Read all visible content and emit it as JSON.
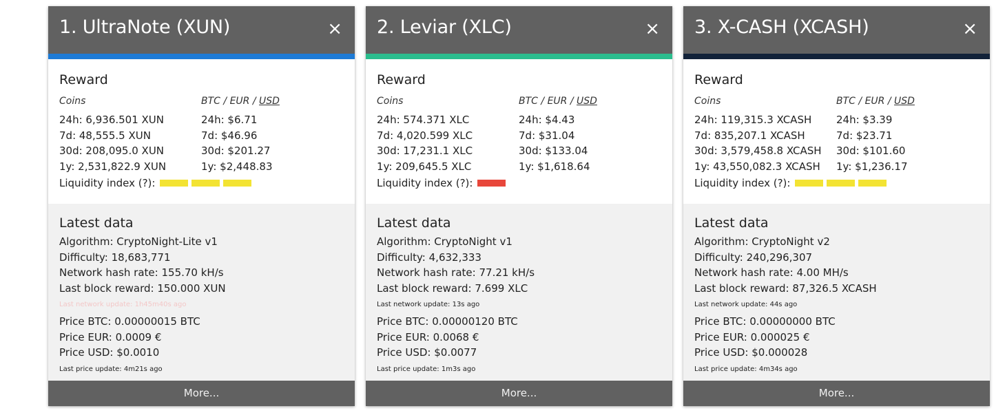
{
  "labels": {
    "reward": "Reward",
    "coins": "Coins",
    "btc": "BTC",
    "eur": "EUR",
    "usd": "USD",
    "sep": " / ",
    "liquidity": "Liquidity index (?):",
    "latest": "Latest data",
    "more": "More...",
    "close": "×"
  },
  "cards": [
    {
      "title": "1. UltraNote (XUN)",
      "accent_color": "#1e7bd6",
      "reward_coins": [
        "24h: 6,936.501 XUN",
        "7d: 48,555.5 XUN",
        "30d: 208,095.0 XUN",
        "1y: 2,531,822.9 XUN"
      ],
      "reward_fiat": [
        "24h: $6.71",
        "7d: $46.96",
        "30d: $201.27",
        "1y: $2,448.83"
      ],
      "liquidity_bars": 3,
      "liquidity_color": "#f3e333",
      "algorithm": "Algorithm: CryptoNight-Lite v1",
      "difficulty": "Difficulty: 18,683,771",
      "hashrate": "Network hash rate: 155.70 kH/s",
      "block_reward": "Last block reward: 150.000 XUN",
      "network_update": "Last network update: 1h45m40s ago",
      "network_update_stale": true,
      "price_btc": "Price BTC: 0.00000015 BTC",
      "price_eur": "Price EUR: 0.0009 €",
      "price_usd": "Price USD: $0.0010",
      "price_update": "Last price update: 4m21s ago"
    },
    {
      "title": "2. Leviar (XLC)",
      "accent_color": "#2bbd8e",
      "reward_coins": [
        "24h: 574.371 XLC",
        "7d: 4,020.599 XLC",
        "30d: 17,231.1 XLC",
        "1y: 209,645.5 XLC"
      ],
      "reward_fiat": [
        "24h: $4.43",
        "7d: $31.04",
        "30d: $133.04",
        "1y: $1,618.64"
      ],
      "liquidity_bars": 1,
      "liquidity_color": "#e8473b",
      "algorithm": "Algorithm: CryptoNight v1",
      "difficulty": "Difficulty: 4,632,333",
      "hashrate": "Network hash rate: 77.21 kH/s",
      "block_reward": "Last block reward: 7.699 XLC",
      "network_update": "Last network update: 13s ago",
      "network_update_stale": false,
      "price_btc": "Price BTC: 0.00000120 BTC",
      "price_eur": "Price EUR: 0.0068 €",
      "price_usd": "Price USD: $0.0077",
      "price_update": "Last price update: 1m3s ago"
    },
    {
      "title": "3. X-CASH (XCASH)",
      "accent_color": "#122239",
      "reward_coins": [
        "24h: 119,315.3 XCASH",
        "7d: 835,207.1 XCASH",
        "30d: 3,579,458.8 XCASH",
        "1y: 43,550,082.3 XCASH"
      ],
      "reward_fiat": [
        "24h: $3.39",
        "7d: $23.71",
        "30d: $101.60",
        "1y: $1,236.17"
      ],
      "liquidity_bars": 3,
      "liquidity_color": "#f3e333",
      "algorithm": "Algorithm: CryptoNight v2",
      "difficulty": "Difficulty: 240,296,307",
      "hashrate": "Network hash rate: 4.00 MH/s",
      "block_reward": "Last block reward: 87,326.5 XCASH",
      "network_update": "Last network update: 44s ago",
      "network_update_stale": false,
      "price_btc": "Price BTC: 0.00000000 BTC",
      "price_eur": "Price EUR: 0.000025 €",
      "price_usd": "Price USD: $0.000028",
      "price_update": "Last price update: 4m34s ago"
    }
  ]
}
